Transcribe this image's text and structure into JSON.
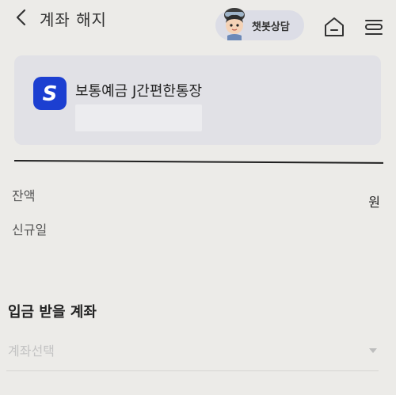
{
  "header": {
    "back_icon": "chevron-left-icon",
    "title": "계좌 해지",
    "chatbot_label": "챗봇상담",
    "home_icon": "home-icon",
    "menu_icon": "menu-icon"
  },
  "account": {
    "logo_icon": "bank-logo-icon",
    "logo_letter": "S",
    "name": "보통예금 J간편한통장",
    "number": ""
  },
  "info": {
    "balance_label": "잔액",
    "balance_unit": "원",
    "open_date_label": "신규일",
    "open_date_value": ""
  },
  "deposit": {
    "section_title": "입금 받을 계좌",
    "select_placeholder": "계좌선택"
  },
  "colors": {
    "background": "#ecebe8",
    "card": "#e1e1e6",
    "brand_blue": "#1c3fd1",
    "chatbot_bg": "#dcdde6"
  }
}
